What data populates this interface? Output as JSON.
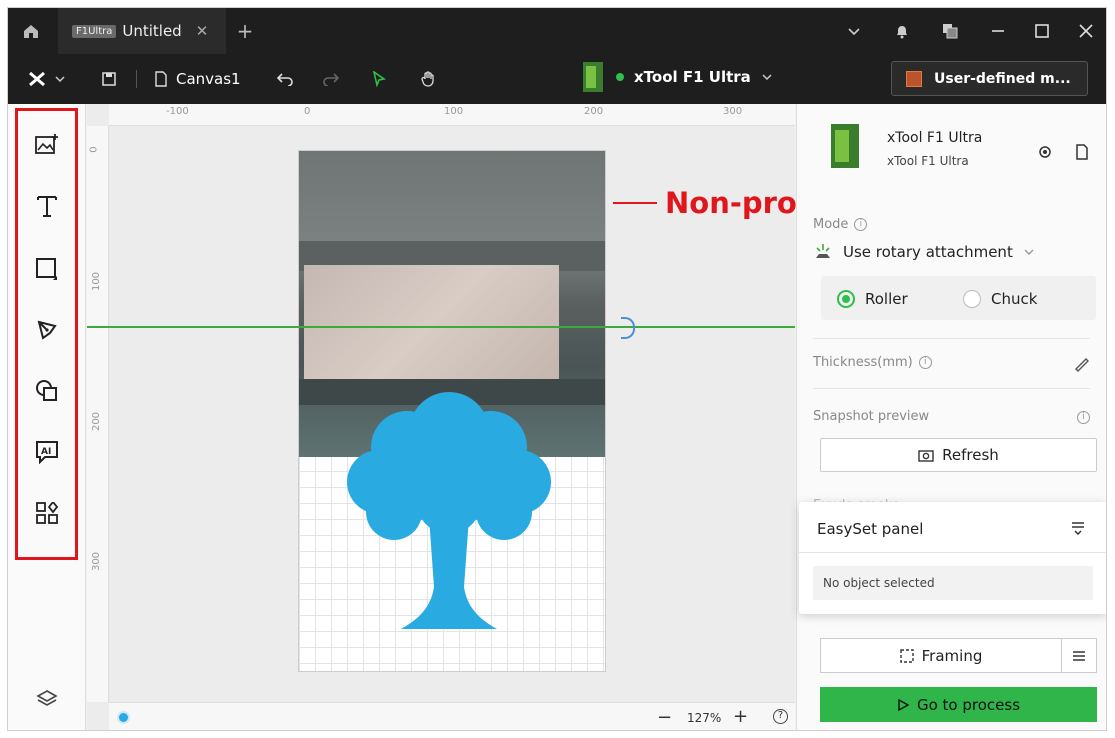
{
  "titlebar": {
    "badge": "F1Ultra",
    "tab_title": "Untitled"
  },
  "toolbar": {
    "canvas_name": "Canvas1",
    "device_name": "xTool F1 Ultra",
    "material": "User-defined m..."
  },
  "device": {
    "name": "xTool F1 Ultra",
    "model": "xTool F1 Ultra"
  },
  "ruler": {
    "top": [
      "-100",
      "0",
      "100",
      "200",
      "300"
    ],
    "left": [
      "0",
      "100",
      "200",
      "300"
    ]
  },
  "annotation": {
    "text": "Non-processing area"
  },
  "mode": {
    "label": "Mode",
    "value": "Use rotary attachment",
    "options": [
      "Roller",
      "Chuck"
    ],
    "selected": "Roller"
  },
  "thickness": {
    "label": "Thickness(mm)"
  },
  "snapshot": {
    "label": "Snapshot preview",
    "refresh": "Refresh"
  },
  "hidden": {
    "label": "Exude smoke"
  },
  "easyset": {
    "title": "EasySet panel",
    "empty": "No object selected"
  },
  "actions": {
    "framing": "Framing",
    "process": "Go to process"
  },
  "zoom": {
    "value": "127%"
  }
}
